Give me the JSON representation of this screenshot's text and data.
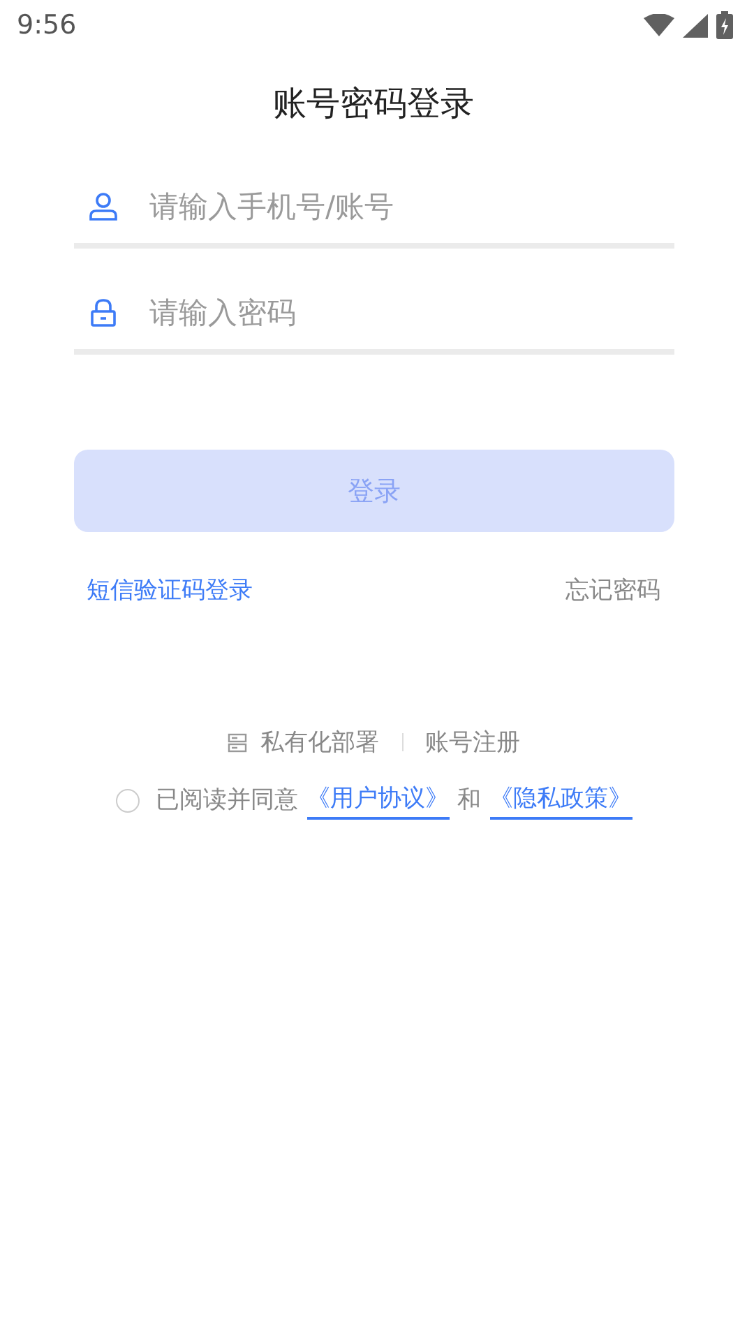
{
  "status_bar": {
    "time": "9:56"
  },
  "title": "账号密码登录",
  "fields": [
    {
      "kind": "user",
      "placeholder": "请输入手机号/账号"
    },
    {
      "kind": "lock",
      "placeholder": "请输入密码"
    }
  ],
  "login_button": {
    "label": "登录",
    "disabled": true
  },
  "links": {
    "sms_login": "短信验证码登录",
    "forgot_password": "忘记密码"
  },
  "footer": {
    "private_deploy": "私有化部署",
    "register": "账号注册"
  },
  "agreement": {
    "checked": false,
    "text": "已阅读并同意",
    "user_agreement": "《用户协议》",
    "and": "和",
    "privacy_policy": "《隐私政策》"
  }
}
